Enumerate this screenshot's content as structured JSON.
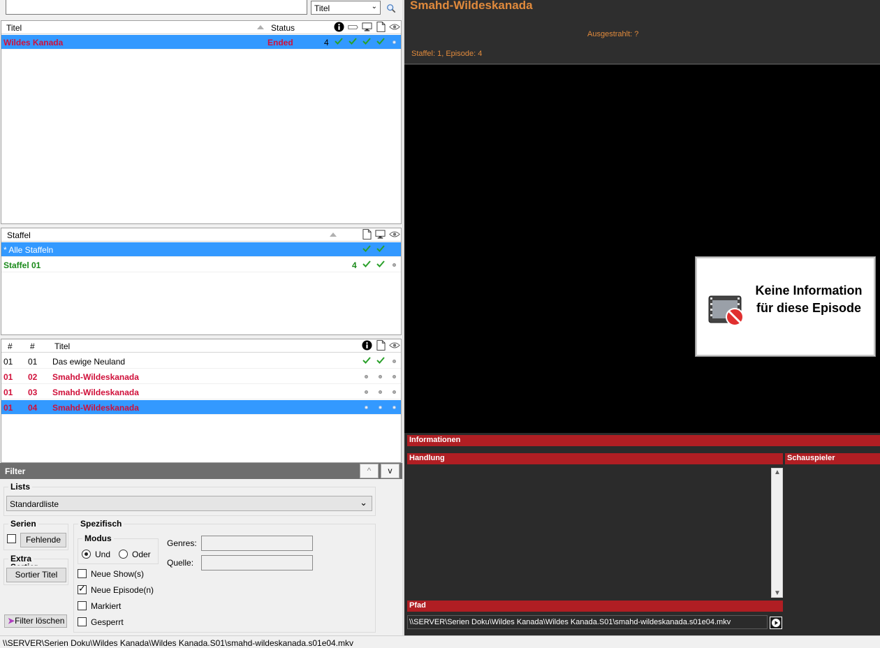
{
  "search": {
    "value": "",
    "field_selected": "Titel"
  },
  "series_list": {
    "headers": {
      "title": "Titel",
      "status": "Status"
    },
    "rows": [
      {
        "title": "Wildes Kanada",
        "status": "Ended",
        "count": "4"
      }
    ]
  },
  "season_list": {
    "headers": {
      "title": "Staffel"
    },
    "rows": [
      {
        "title": "* Alle Staffeln",
        "count": ""
      },
      {
        "title": "Staffel 01",
        "count": "4"
      }
    ]
  },
  "episode_list": {
    "headers": {
      "season": "#",
      "episode": "#",
      "title": "Titel"
    },
    "rows": [
      {
        "season": "01",
        "episode": "01",
        "title": "Das ewige Neuland"
      },
      {
        "season": "01",
        "episode": "02",
        "title": "Smahd-Wildeskanada"
      },
      {
        "season": "01",
        "episode": "03",
        "title": "Smahd-Wildeskanada"
      },
      {
        "season": "01",
        "episode": "04",
        "title": "Smahd-Wildeskanada"
      }
    ]
  },
  "filter": {
    "title": "Filter",
    "up_label": "^",
    "down_label": "v",
    "lists_label": "Lists",
    "lists_selected": "Standardliste",
    "serien_label": "Serien",
    "fehlende_label": "Fehlende",
    "extra_label": "Extra",
    "extra_clipped": "Sortier",
    "sortier_label": "Sortier Titel",
    "spezifisch_label": "Spezifisch",
    "modus_label": "Modus",
    "und_label": "Und",
    "oder_label": "Oder",
    "genres_label": "Genres:",
    "quelle_label": "Quelle:",
    "neue_shows_label": "Neue Show(s)",
    "neue_episoden_label": "Neue Episode(n)",
    "markiert_label": "Markiert",
    "gesperrt_label": "Gesperrt",
    "clear_label": "Filter löschen"
  },
  "detail": {
    "episode_title": "Smahd-Wildeskanada",
    "aired": "Ausgestrahlt: ?",
    "season_episode": "Staffel: 1, Episode: 4",
    "no_info": "Keine Information für diese Episode",
    "info_label": "Informationen",
    "plot_label": "Handlung",
    "actors_label": "Schauspieler",
    "path_label": "Pfad",
    "path_value": "\\\\SERVER\\Serien Doku\\Wildes Kanada\\Wildes Kanada.S01\\smahd-wildeskanada.s01e04.mkv"
  },
  "statusbar": {
    "path": "\\\\SERVER\\Serien Doku\\Wildes Kanada\\Wildes Kanada.S01\\smahd-wildeskanada.s01e04.mkv"
  },
  "colors": {
    "selection": "#3399ff",
    "accent_red": "#b01e23",
    "title_orange": "#e08a3c",
    "dark_bg": "#2b2b2b"
  }
}
